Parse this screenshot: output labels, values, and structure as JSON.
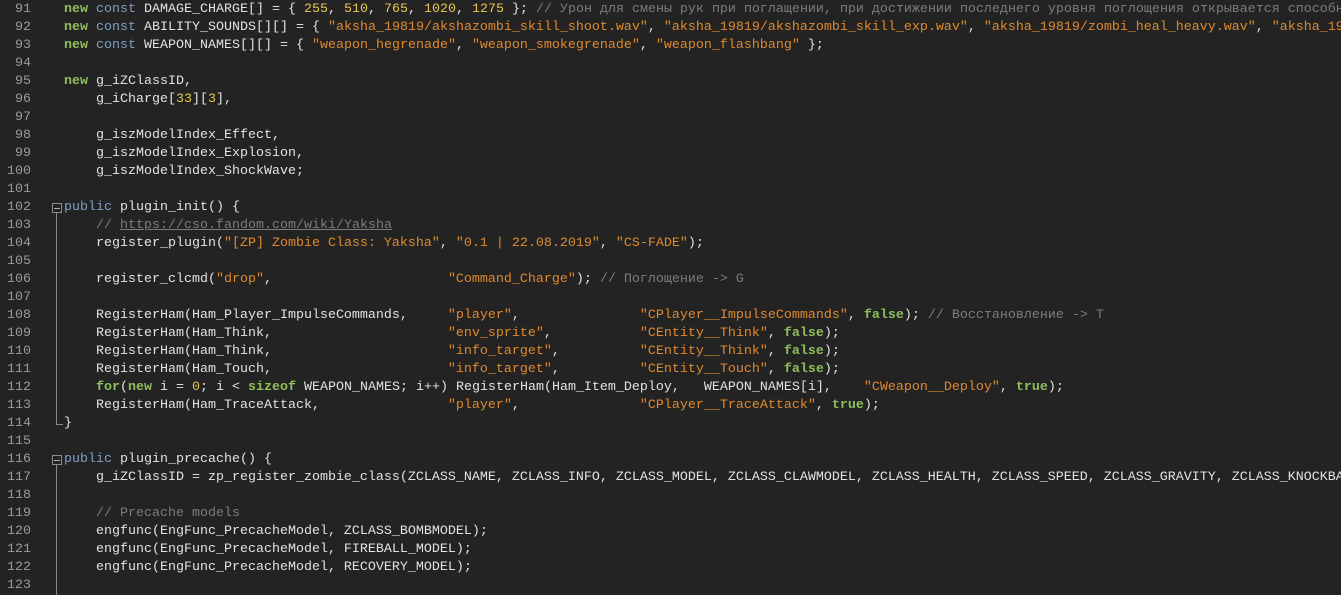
{
  "editor": {
    "lines": [
      {
        "num": "91",
        "tokens": [
          {
            "k": "kw",
            "t": "new"
          },
          {
            "k": "p",
            "t": " "
          },
          {
            "k": "ty",
            "t": "const"
          },
          {
            "k": "p",
            "t": " DAMAGE_CHARGE[] = { "
          },
          {
            "k": "n",
            "t": "255"
          },
          {
            "k": "p",
            "t": ", "
          },
          {
            "k": "n",
            "t": "510"
          },
          {
            "k": "p",
            "t": ", "
          },
          {
            "k": "n",
            "t": "765"
          },
          {
            "k": "p",
            "t": ", "
          },
          {
            "k": "n",
            "t": "1020"
          },
          {
            "k": "p",
            "t": ", "
          },
          {
            "k": "n",
            "t": "1275"
          },
          {
            "k": "p",
            "t": " }; "
          },
          {
            "k": "c",
            "t": "// Урон для смены рук при поглащении, при достижении последнего уровня поглощения открывается способн"
          }
        ]
      },
      {
        "num": "92",
        "tokens": [
          {
            "k": "kw",
            "t": "new"
          },
          {
            "k": "p",
            "t": " "
          },
          {
            "k": "ty",
            "t": "const"
          },
          {
            "k": "p",
            "t": " ABILITY_SOUNDS[][] = { "
          },
          {
            "k": "s",
            "t": "\"aksha_19819/akshazombi_skill_shoot.wav\""
          },
          {
            "k": "p",
            "t": ", "
          },
          {
            "k": "s",
            "t": "\"aksha_19819/akshazombi_skill_exp.wav\""
          },
          {
            "k": "p",
            "t": ", "
          },
          {
            "k": "s",
            "t": "\"aksha_19819/zombi_heal_heavy.wav\""
          },
          {
            "k": "p",
            "t": ", "
          },
          {
            "k": "s",
            "t": "\"aksha_19"
          }
        ]
      },
      {
        "num": "93",
        "tokens": [
          {
            "k": "kw",
            "t": "new"
          },
          {
            "k": "p",
            "t": " "
          },
          {
            "k": "ty",
            "t": "const"
          },
          {
            "k": "p",
            "t": " WEAPON_NAMES[][] = { "
          },
          {
            "k": "s",
            "t": "\"weapon_hegrenade\""
          },
          {
            "k": "p",
            "t": ", "
          },
          {
            "k": "s",
            "t": "\"weapon_smokegrenade\""
          },
          {
            "k": "p",
            "t": ", "
          },
          {
            "k": "s",
            "t": "\"weapon_flashbang\""
          },
          {
            "k": "p",
            "t": " };"
          }
        ]
      },
      {
        "num": "94",
        "tokens": []
      },
      {
        "num": "95",
        "tokens": [
          {
            "k": "kw",
            "t": "new"
          },
          {
            "k": "p",
            "t": " g_iZClassID,"
          }
        ]
      },
      {
        "num": "96",
        "tokens": [
          {
            "k": "p",
            "t": "    g_iCharge["
          },
          {
            "k": "n",
            "t": "33"
          },
          {
            "k": "p",
            "t": "]["
          },
          {
            "k": "n",
            "t": "3"
          },
          {
            "k": "p",
            "t": "],"
          }
        ]
      },
      {
        "num": "97",
        "tokens": []
      },
      {
        "num": "98",
        "tokens": [
          {
            "k": "p",
            "t": "    g_iszModelIndex_Effect,"
          }
        ]
      },
      {
        "num": "99",
        "tokens": [
          {
            "k": "p",
            "t": "    g_iszModelIndex_Explosion,"
          }
        ]
      },
      {
        "num": "100",
        "tokens": [
          {
            "k": "p",
            "t": "    g_iszModelIndex_ShockWave;"
          }
        ]
      },
      {
        "num": "101",
        "tokens": []
      },
      {
        "num": "102",
        "fold": "open",
        "tokens": [
          {
            "k": "ty",
            "t": "public"
          },
          {
            "k": "p",
            "t": " plugin_init() {"
          }
        ]
      },
      {
        "num": "103",
        "tokens": [
          {
            "k": "p",
            "t": "    "
          },
          {
            "k": "c",
            "t": "// "
          },
          {
            "k": "u",
            "t": "https://cso.fandom.com/wiki/Yaksha"
          }
        ]
      },
      {
        "num": "104",
        "tokens": [
          {
            "k": "p",
            "t": "    register_plugin("
          },
          {
            "k": "s",
            "t": "\"[ZP] Zombie Class: Yaksha\""
          },
          {
            "k": "p",
            "t": ", "
          },
          {
            "k": "s",
            "t": "\"0.1 | 22.08.2019\""
          },
          {
            "k": "p",
            "t": ", "
          },
          {
            "k": "s",
            "t": "\"CS-FADE\""
          },
          {
            "k": "p",
            "t": ");"
          }
        ]
      },
      {
        "num": "105",
        "tokens": []
      },
      {
        "num": "106",
        "tokens": [
          {
            "k": "p",
            "t": "    register_clcmd("
          },
          {
            "k": "s",
            "t": "\"drop\""
          },
          {
            "k": "p",
            "t": ",                      "
          },
          {
            "k": "s",
            "t": "\"Command_Charge\""
          },
          {
            "k": "p",
            "t": "); "
          },
          {
            "k": "c",
            "t": "// Поглощение -> G"
          }
        ]
      },
      {
        "num": "107",
        "tokens": []
      },
      {
        "num": "108",
        "tokens": [
          {
            "k": "p",
            "t": "    RegisterHam(Ham_Player_ImpulseCommands,     "
          },
          {
            "k": "s",
            "t": "\"player\""
          },
          {
            "k": "p",
            "t": ",               "
          },
          {
            "k": "s",
            "t": "\"CPlayer__ImpulseCommands\""
          },
          {
            "k": "p",
            "t": ", "
          },
          {
            "k": "kw",
            "t": "false"
          },
          {
            "k": "p",
            "t": "); "
          },
          {
            "k": "c",
            "t": "// Восстановление -> T"
          }
        ]
      },
      {
        "num": "109",
        "tokens": [
          {
            "k": "p",
            "t": "    RegisterHam(Ham_Think,                      "
          },
          {
            "k": "s",
            "t": "\"env_sprite\""
          },
          {
            "k": "p",
            "t": ",           "
          },
          {
            "k": "s",
            "t": "\"CEntity__Think\""
          },
          {
            "k": "p",
            "t": ", "
          },
          {
            "k": "kw",
            "t": "false"
          },
          {
            "k": "p",
            "t": ");"
          }
        ]
      },
      {
        "num": "110",
        "tokens": [
          {
            "k": "p",
            "t": "    RegisterHam(Ham_Think,                      "
          },
          {
            "k": "s",
            "t": "\"info_target\""
          },
          {
            "k": "p",
            "t": ",          "
          },
          {
            "k": "s",
            "t": "\"CEntity__Think\""
          },
          {
            "k": "p",
            "t": ", "
          },
          {
            "k": "kw",
            "t": "false"
          },
          {
            "k": "p",
            "t": ");"
          }
        ]
      },
      {
        "num": "111",
        "tokens": [
          {
            "k": "p",
            "t": "    RegisterHam(Ham_Touch,                      "
          },
          {
            "k": "s",
            "t": "\"info_target\""
          },
          {
            "k": "p",
            "t": ",          "
          },
          {
            "k": "s",
            "t": "\"CEntity__Touch\""
          },
          {
            "k": "p",
            "t": ", "
          },
          {
            "k": "kw",
            "t": "false"
          },
          {
            "k": "p",
            "t": ");"
          }
        ]
      },
      {
        "num": "112",
        "tokens": [
          {
            "k": "p",
            "t": "    "
          },
          {
            "k": "kw",
            "t": "for"
          },
          {
            "k": "p",
            "t": "("
          },
          {
            "k": "kw",
            "t": "new"
          },
          {
            "k": "p",
            "t": " i = "
          },
          {
            "k": "n",
            "t": "0"
          },
          {
            "k": "p",
            "t": "; i < "
          },
          {
            "k": "kw",
            "t": "sizeof"
          },
          {
            "k": "p",
            "t": " WEAPON_NAMES; i++) RegisterHam(Ham_Item_Deploy,   WEAPON_NAMES[i],    "
          },
          {
            "k": "s",
            "t": "\"CWeapon__Deploy\""
          },
          {
            "k": "p",
            "t": ", "
          },
          {
            "k": "kw",
            "t": "true"
          },
          {
            "k": "p",
            "t": ");"
          }
        ]
      },
      {
        "num": "113",
        "tokens": [
          {
            "k": "p",
            "t": "    RegisterHam(Ham_TraceAttack,                "
          },
          {
            "k": "s",
            "t": "\"player\""
          },
          {
            "k": "p",
            "t": ",               "
          },
          {
            "k": "s",
            "t": "\"CPlayer__TraceAttack\""
          },
          {
            "k": "p",
            "t": ", "
          },
          {
            "k": "kw",
            "t": "true"
          },
          {
            "k": "p",
            "t": ");"
          }
        ]
      },
      {
        "num": "114",
        "fold": "end",
        "tokens": [
          {
            "k": "p",
            "t": "}"
          }
        ]
      },
      {
        "num": "115",
        "tokens": []
      },
      {
        "num": "116",
        "fold": "open",
        "tokens": [
          {
            "k": "ty",
            "t": "public"
          },
          {
            "k": "p",
            "t": " plugin_precache() {"
          }
        ]
      },
      {
        "num": "117",
        "tokens": [
          {
            "k": "p",
            "t": "    g_iZClassID = zp_register_zombie_class(ZCLASS_NAME, ZCLASS_INFO, ZCLASS_MODEL, ZCLASS_CLAWMODEL, ZCLASS_HEALTH, ZCLASS_SPEED, ZCLASS_GRAVITY, ZCLASS_KNOCKBA"
          }
        ]
      },
      {
        "num": "118",
        "tokens": []
      },
      {
        "num": "119",
        "tokens": [
          {
            "k": "p",
            "t": "    "
          },
          {
            "k": "c",
            "t": "// Precache models"
          }
        ]
      },
      {
        "num": "120",
        "tokens": [
          {
            "k": "p",
            "t": "    engfunc(EngFunc_PrecacheModel, ZCLASS_BOMBMODEL);"
          }
        ]
      },
      {
        "num": "121",
        "tokens": [
          {
            "k": "p",
            "t": "    engfunc(EngFunc_PrecacheModel, FIREBALL_MODEL);"
          }
        ]
      },
      {
        "num": "122",
        "tokens": [
          {
            "k": "p",
            "t": "    engfunc(EngFunc_PrecacheModel, RECOVERY_MODEL);"
          }
        ]
      },
      {
        "num": "123",
        "tokens": []
      }
    ]
  }
}
